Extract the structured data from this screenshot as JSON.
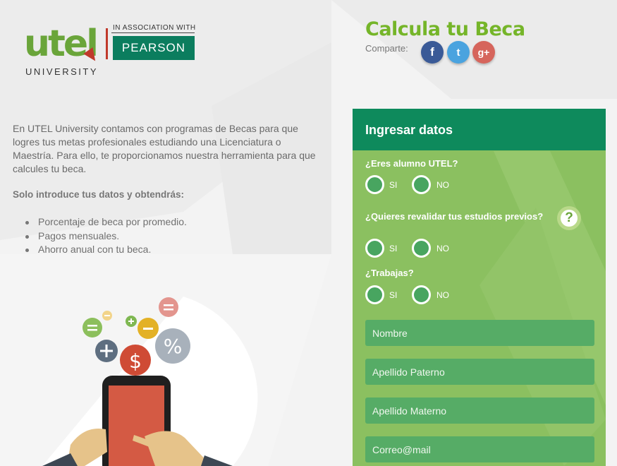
{
  "logo": {
    "brand": "utel",
    "sub": "UNIVERSITY",
    "assoc": "IN ASSOCIATION WITH",
    "partner": "PEARSON"
  },
  "header": {
    "title": "Calcula tu Beca",
    "share_label": "Comparte:"
  },
  "social": [
    {
      "name": "facebook-icon",
      "glyph": "f",
      "color": "#3a5a97"
    },
    {
      "name": "twitter-icon",
      "glyph": "t",
      "color": "#4aa3df"
    },
    {
      "name": "google-plus-icon",
      "glyph": "g+",
      "color": "#d6655c"
    }
  ],
  "intro": {
    "text": "En UTEL University contamos con programas de Becas para que logres tus metas profesionales estudiando una Licenciatura o Maestría. Para ello, te proporcionamos nuestra herramienta para que calcules tu beca.",
    "bold": "Solo introduce tus datos y obtendrás:",
    "bullets": [
      "Porcentaje de beca por promedio.",
      "Pagos mensuales.",
      "Ahorro anual con tu beca."
    ]
  },
  "form": {
    "title": "Ingresar datos",
    "q1": "¿Eres alumno UTEL?",
    "q2": "¿Quieres revalidar tus estudios previos?",
    "q3": "¿Trabajas?",
    "yes": "SI",
    "no": "NO",
    "help_glyph": "?",
    "fields": {
      "nombre": "Nombre",
      "paterno": "Apellido Paterno",
      "materno": "Apellido Materno",
      "correo": "Correo@mail"
    }
  },
  "colors": {
    "accent": "#75b529",
    "panel": "#8bc060",
    "header": "#0e8a5c",
    "field": "#56ac66"
  }
}
